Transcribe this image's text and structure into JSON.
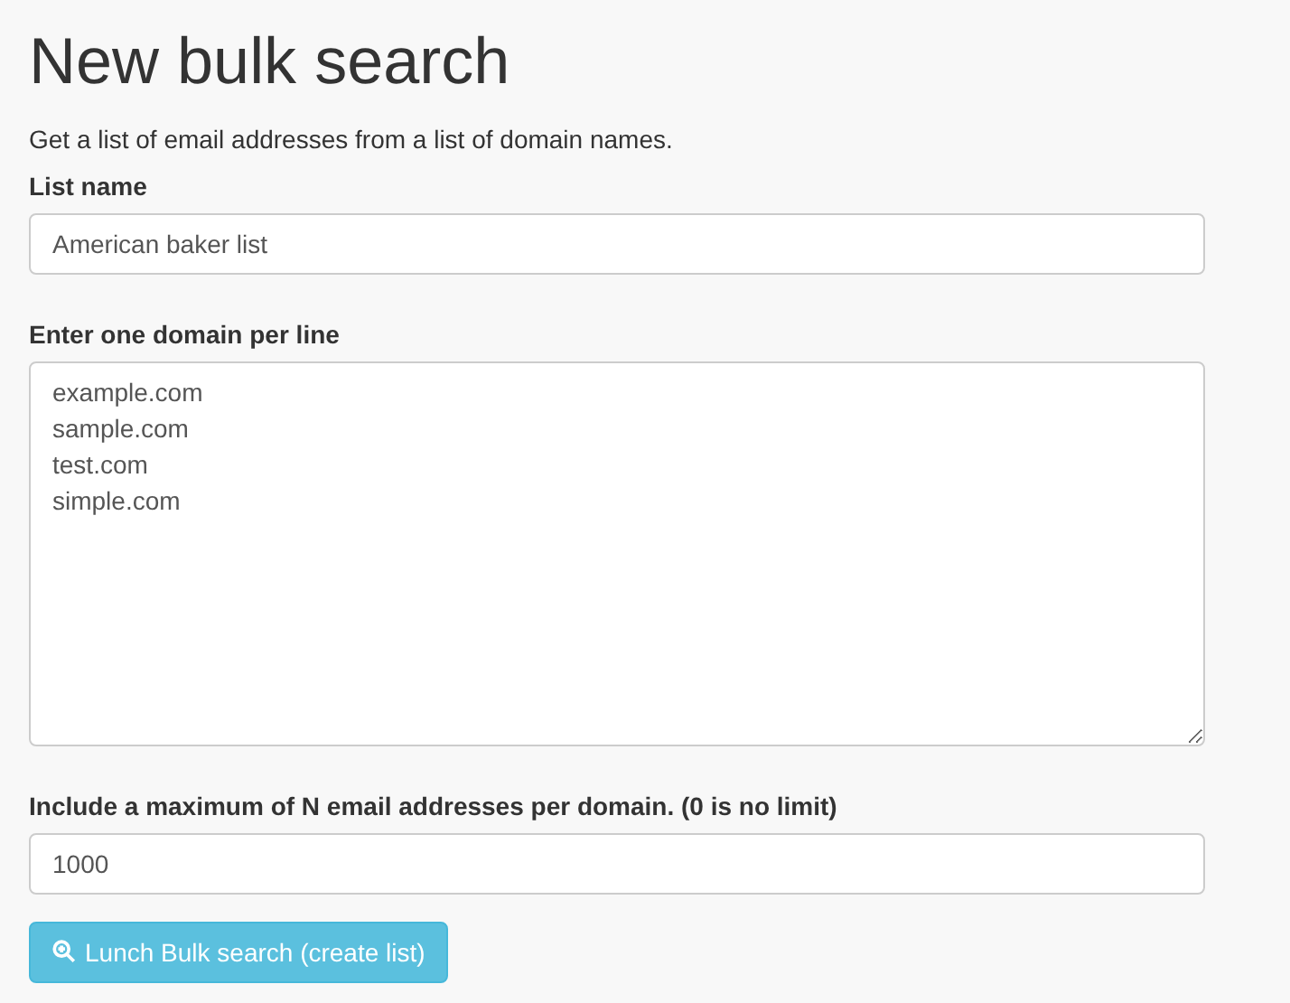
{
  "title": "New bulk search",
  "description": "Get a list of email addresses from a list of domain names.",
  "list_name": {
    "label": "List name",
    "value": "American baker list"
  },
  "domains": {
    "label": "Enter one domain per line",
    "lines": [
      "example.com",
      "sample.com",
      "test.com",
      "simple.com"
    ]
  },
  "max_emails": {
    "label": "Include a maximum of N email addresses per domain. (0 is no limit)",
    "value": "1000"
  },
  "submit_button": {
    "label": "Lunch Bulk search (create list)"
  }
}
